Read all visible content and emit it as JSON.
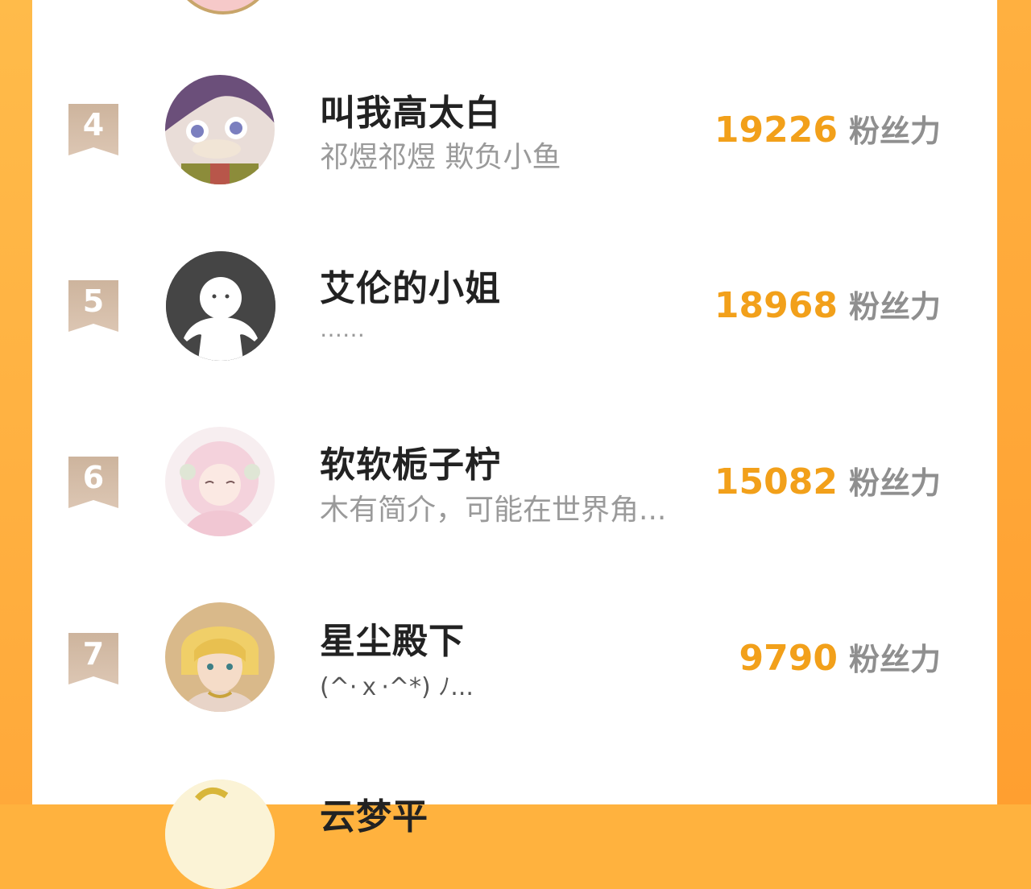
{
  "theme": {
    "accent": "#f2a01a",
    "badge": "#c9ab92",
    "frame": "#ffb23e"
  },
  "entries": [
    {
      "rank": "4",
      "name": "叫我高太白",
      "desc": "祁煜祁煜 欺负小鱼",
      "fans": "19226",
      "unit": "粉丝力"
    },
    {
      "rank": "5",
      "name": "艾伦的小姐",
      "desc": "……",
      "fans": "18968",
      "unit": "粉丝力"
    },
    {
      "rank": "6",
      "name": "软软栀子柠",
      "desc": "木有简介，可能在世界角...",
      "fans": "15082",
      "unit": "粉丝力"
    },
    {
      "rank": "7",
      "name": "星尘殿下",
      "desc": "(^·ｘ·^*) ﾉ...",
      "fans": "9790",
      "unit": "粉丝力"
    },
    {
      "rank": "",
      "name": "云梦平",
      "desc": "",
      "fans": "",
      "unit": ""
    }
  ]
}
